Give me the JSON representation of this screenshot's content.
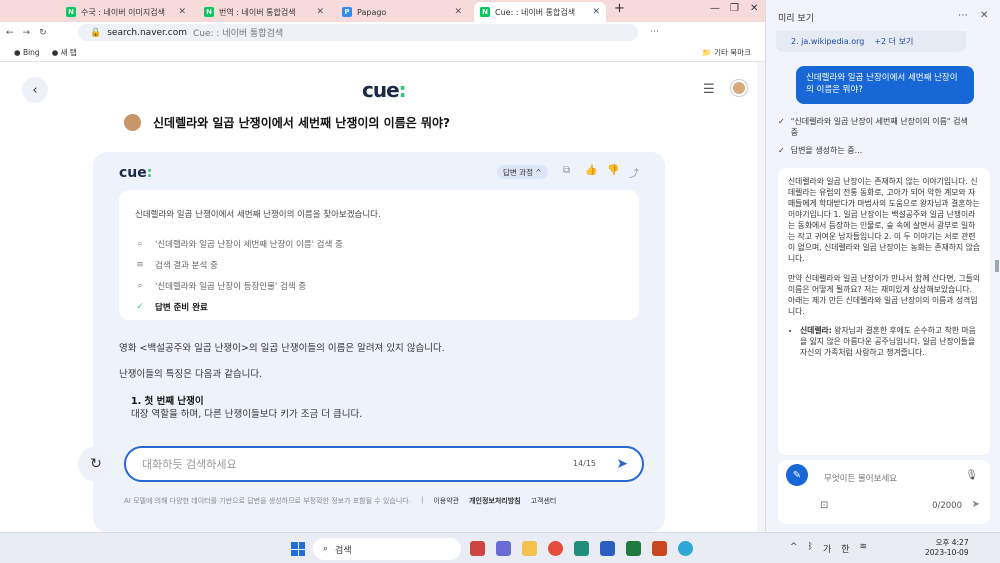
{
  "browser": {
    "tabs": [
      {
        "title": "수국 : 네이버 이미지검색",
        "favicon": "N",
        "color": "#03c75a",
        "active": false
      },
      {
        "title": "번역 : 네이버 통합검색",
        "favicon": "N",
        "color": "#03c75a",
        "active": false
      },
      {
        "title": "Papago",
        "favicon": "P",
        "color": "#2e8df0",
        "active": false
      },
      {
        "title": "Cue: : 네이버 통합검색",
        "favicon": "N",
        "color": "#03c75a",
        "active": true
      }
    ],
    "new_tab": "+",
    "url": "search.naver.com",
    "url_suffix": "Cue: : 네이버 통합검색",
    "bookmarks": [
      "Bing",
      "새 탭"
    ],
    "bookmark_other": "기타 북마크"
  },
  "cue": {
    "logo_main": "cue",
    "logo_accent": ":",
    "question": "신데렐라와 일곱 난쟁이에서 세번째 난쟁이의 이름은 뭐야?",
    "process_label": "답변 과정 ^",
    "steps_intro": "신데렐라와 일곱 난쟁이에서 세번째 난쟁이의 이름을 찾아보겠습니다.",
    "steps": [
      {
        "icon": "search-icon",
        "text": "'신데렐라와 일곱 난장이 세번째 난장이 이름' 검색 중",
        "done": false
      },
      {
        "icon": "list-icon",
        "text": "검색 결과 분석 중",
        "done": false
      },
      {
        "icon": "search-icon",
        "text": "'신데렐라와 일곱 난장이 등장인물' 검색 중",
        "done": false
      },
      {
        "icon": "check-icon",
        "text": "답변 준비 완료",
        "done": true
      }
    ],
    "answer_p1": "영화 <백설공주와 일곱 난쟁이>의 일곱 난쟁이들의 이름은 알려져 있지 않습니다.",
    "answer_p2": "난쟁이들의 특징은 다음과 같습니다.",
    "list_item_title": "1. 첫 번째 난쟁이",
    "list_item_desc": "대장 역할을 하며, 다른 난쟁이들보다 키가 조금 더 큽니다.",
    "input_placeholder": "대화하듯 검색하세요",
    "input_counter": "14/15",
    "footer_notice": "AI 모델에 의해 다양한 데이터를 기반으로 답변을 생성하므로 부정확한 정보가 포함될 수 있습니다.",
    "footer_links": [
      "이용약관",
      "개인정보처리방침",
      "고객센터"
    ]
  },
  "sidebar": {
    "header": "미리 보기",
    "refs": [
      "2. ja.wikipedia.org",
      "+2 더 보기"
    ],
    "user_bubble": "신데렐라와 일곱 난장이에서 세번째 난장이의 이름은 뭐야?",
    "progress": [
      "\"신데렐라와 일곱 난장이 세번째 난장이의 이름\" 검색 중",
      "답변을 생성하는 중..."
    ],
    "answer_p1": "신데렐라와 일곱 난장이는 존재하지 않는 이야기입니다. 신데렐라는 유럽의 전통 동화로, 고아가 되어 악한 계모와 자매들에게 학대받다가 마법사의 도움으로 왕자님과 결혼하는 이야기입니다 1. 일곱 난장이는 백설공주와 일곱 난쟁이라는 동화에서 등장하는 인물로, 숲 속에 살면서 광부로 일하는 작고 귀여운 남자들입니다 2. 이 두 이야기는 서로 관련이 없으며, 신데렐라와 일곱 난장이는 농화는 존재하지 않습니다.",
    "answer_p2": "만약 신데렐라와 일곱 난장이가 만나서 함께 산다면, 그들의 이름은 어떻게 될까요? 저는 재미있게 상상해보았습니다. 아래는 제가 만든 신데렐라와 일곱 난장이의 이름과 성격입니다.",
    "bullet_title": "신데렐라:",
    "bullet_text": "왕자님과 결혼한 후에도 순수하고 착한 마음을 잃지 않은 아름다운 공주님입니다. 일곱 난장이들을 자신의 가족처럼 사랑하고 챙겨줍니다.",
    "input_placeholder": "무엇이든 물어보세요",
    "input_counter": "0/2000"
  },
  "taskbar": {
    "search": "검색",
    "tray_lang": "가",
    "tray_ime": "한",
    "time": "오후 4:27",
    "date": "2023-10-09"
  }
}
